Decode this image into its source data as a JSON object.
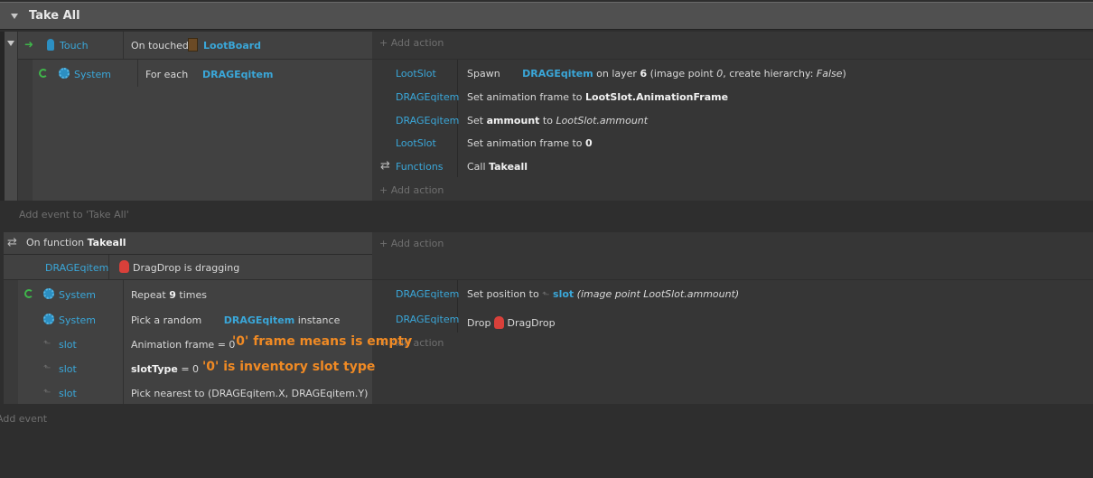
{
  "group": {
    "title": "Take All"
  },
  "events": [
    {
      "trigger": {
        "object": "Touch",
        "text": "On touched",
        "target": "LootBoard"
      },
      "add_action": "Add action",
      "sub": {
        "object": "System",
        "text": "For each",
        "target": "DRAGEqitem",
        "actions": [
          {
            "object": "LootSlot",
            "a": "Spawn",
            "b": "DRAGEqitem",
            "c": "on layer",
            "d": "6",
            "e": "(image point",
            "f": "0",
            "g": ", create hierarchy:",
            "h": "False",
            "i": ")"
          },
          {
            "object": "DRAGEqitem",
            "a": "Set animation frame to",
            "b": "LootSlot.AnimationFrame"
          },
          {
            "object": "DRAGEqitem",
            "a": "Set",
            "b": "ammount",
            "c": "to",
            "d": "LootSlot.ammount"
          },
          {
            "object": "LootSlot",
            "a": "Set animation frame to",
            "b": "0"
          },
          {
            "object": "Functions",
            "a": "Call",
            "b": "Takeall"
          }
        ],
        "add_action": "Add action"
      }
    }
  ],
  "add_event_in_group": "Add event to 'Take All'",
  "function_event": {
    "trigger": {
      "text": "On function",
      "name": "Takeall"
    },
    "add_action": "Add action",
    "cond2": {
      "object": "DRAGEqitem",
      "text": "DragDrop is dragging"
    },
    "sub": {
      "conditions": [
        {
          "object": "System",
          "a": "Repeat",
          "b": "9",
          "c": "times"
        },
        {
          "object": "System",
          "a": "Pick a random",
          "b": "DRAGEqitem",
          "c": "instance"
        },
        {
          "object": "slot",
          "a": "Animation frame = 0"
        },
        {
          "object": "slot",
          "a": "slotType",
          "b": "= 0"
        },
        {
          "object": "slot",
          "a": "Pick nearest to (DRAGEqitem.X, DRAGEqitem.Y)"
        }
      ],
      "actions": [
        {
          "object": "DRAGEqitem",
          "a": "Set position to",
          "b": "slot",
          "c": "(image point LootSlot.ammount)"
        },
        {
          "object": "DRAGEqitem",
          "a": "Drop",
          "b": "DragDrop"
        }
      ],
      "add_action": "Add action"
    }
  },
  "annotations": {
    "a1": "'0' frame means is empty",
    "a2": "'0' is inventory slot type"
  },
  "add_event": "Add event"
}
